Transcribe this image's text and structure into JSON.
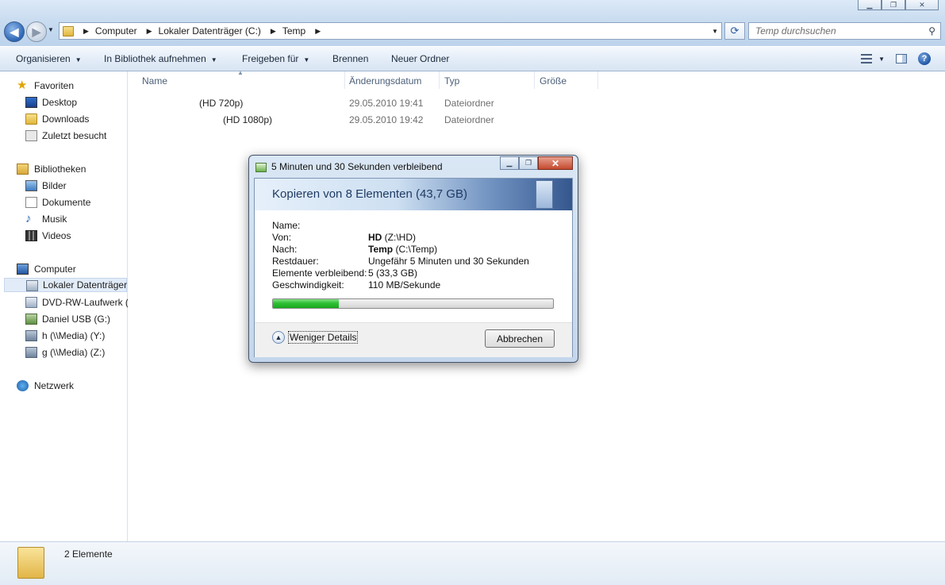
{
  "window": {
    "caption_buttons": [
      "minimize",
      "maximize",
      "close"
    ]
  },
  "address": {
    "crumbs": [
      "Computer",
      "Lokaler Datenträger (C:)",
      "Temp"
    ]
  },
  "search": {
    "placeholder": "Temp durchsuchen"
  },
  "toolbar": {
    "organize": "Organisieren",
    "include_library": "In Bibliothek aufnehmen",
    "share": "Freigeben für",
    "burn": "Brennen",
    "new_folder": "Neuer Ordner"
  },
  "nav": {
    "favorites": {
      "label": "Favoriten",
      "items": [
        "Desktop",
        "Downloads",
        "Zuletzt besucht"
      ]
    },
    "libraries": {
      "label": "Bibliotheken",
      "items": [
        "Bilder",
        "Dokumente",
        "Musik",
        "Videos"
      ]
    },
    "computer": {
      "label": "Computer",
      "items": [
        "Lokaler Datenträger",
        "DVD-RW-Laufwerk (",
        "Daniel USB (G:)",
        "h (\\\\Media) (Y:)",
        "g (\\\\Media) (Z:)"
      ]
    },
    "network": {
      "label": "Netzwerk"
    }
  },
  "columns": {
    "name": "Name",
    "date": "Änderungsdatum",
    "type": "Typ",
    "size": "Größe"
  },
  "files": [
    {
      "name": "(HD 720p)",
      "date": "29.05.2010 19:41",
      "type": "Dateiordner"
    },
    {
      "name": "(HD 1080p)",
      "date": "29.05.2010 19:42",
      "type": "Dateiordner"
    }
  ],
  "status": {
    "count": "2 Elemente"
  },
  "dialog": {
    "title": "5 Minuten und 30 Sekunden verbleibend",
    "heading": "Kopieren von 8 Elementen (43,7 GB)",
    "name_label": "Name:",
    "name_value": "",
    "from_label": "Von:",
    "from_bold": "HD",
    "from_rest": " (Z:\\HD)",
    "to_label": "Nach:",
    "to_bold": "Temp",
    "to_rest": " (C:\\Temp)",
    "remaining_label": "Restdauer:",
    "remaining_value": "Ungefähr 5 Minuten und 30 Sekunden",
    "items_label": "Elemente verbleibend:",
    "items_value": "5 (33,3 GB)",
    "speed_label": "Geschwindigkeit:",
    "speed_value": "110 MB/Sekunde",
    "progress_fraction": 0.235,
    "less_details": "Weniger Details",
    "cancel": "Abbrechen"
  }
}
